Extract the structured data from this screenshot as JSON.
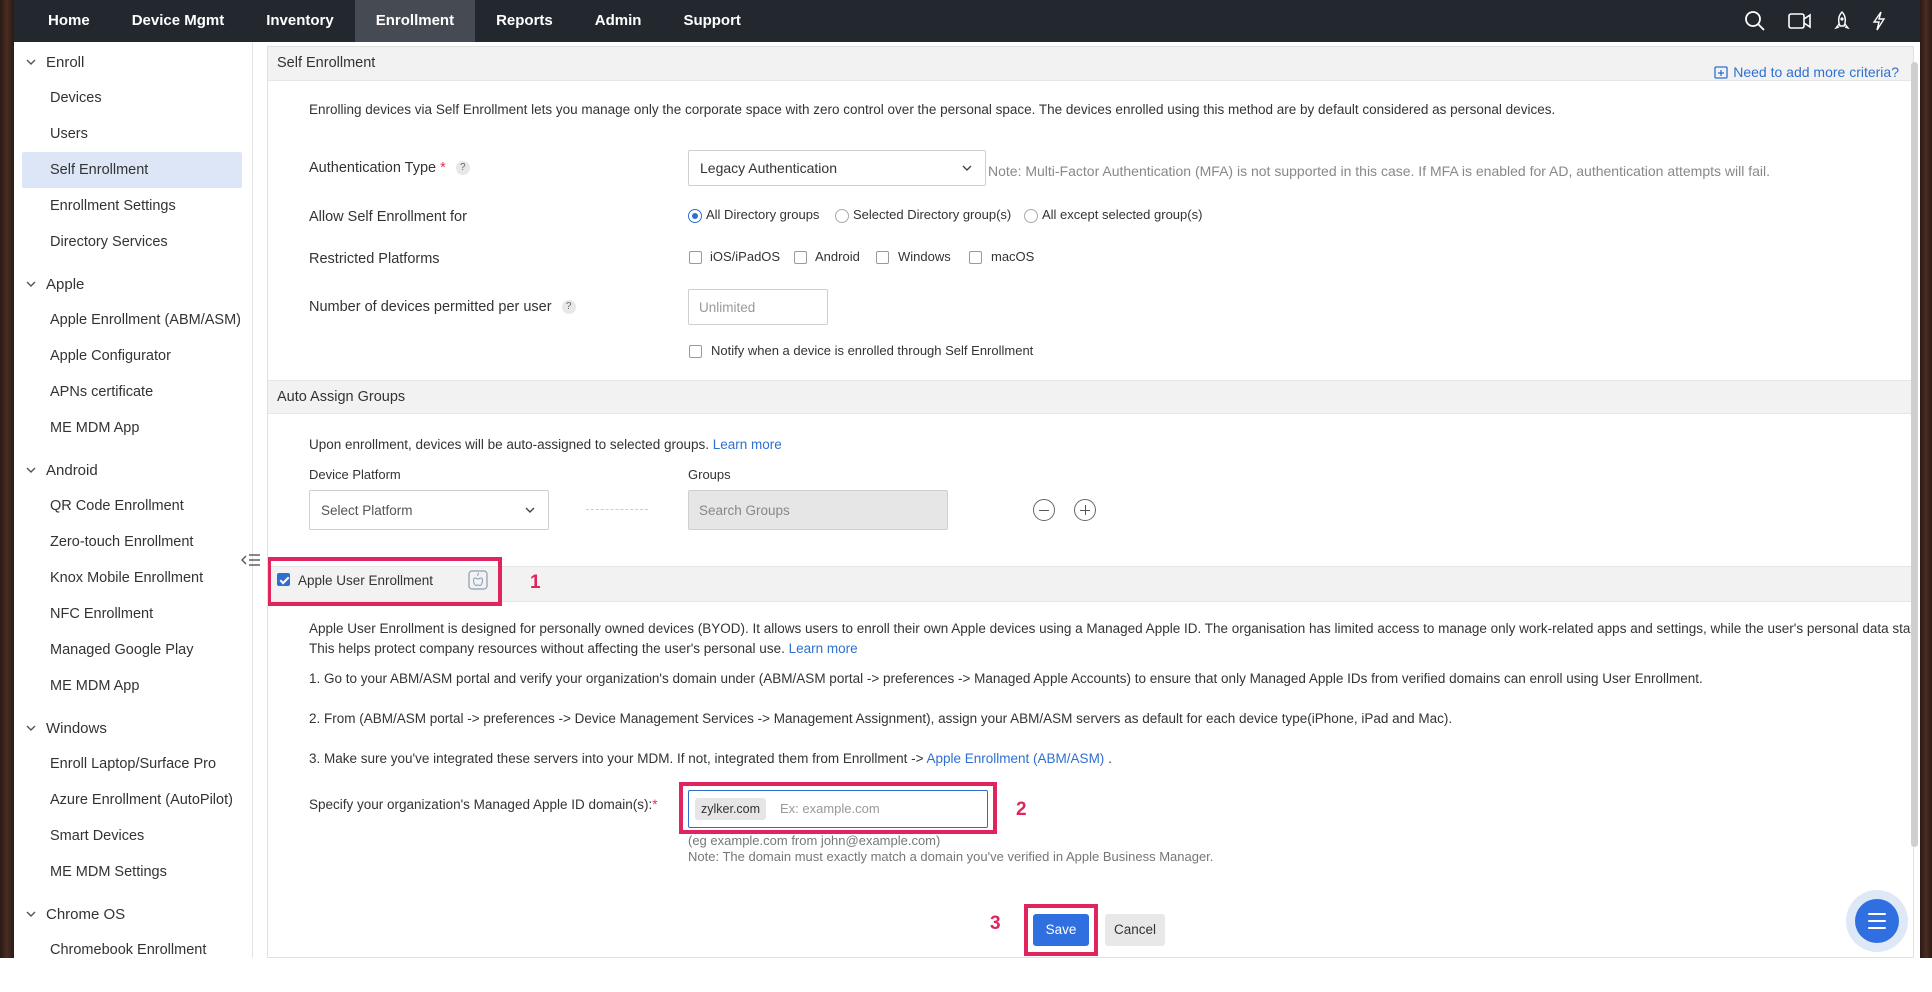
{
  "topnav": {
    "items": [
      "Home",
      "Device Mgmt",
      "Inventory",
      "Enrollment",
      "Reports",
      "Admin",
      "Support"
    ],
    "active": "Enrollment",
    "icons": [
      "search-icon",
      "video-icon",
      "rocket-icon",
      "lightning-icon"
    ]
  },
  "sidebar": {
    "sections": [
      {
        "title": "Enroll",
        "items": [
          "Devices",
          "Users",
          "Self Enrollment",
          "Enrollment Settings",
          "Directory Services"
        ]
      },
      {
        "title": "Apple",
        "items": [
          "Apple Enrollment (ABM/ASM)",
          "Apple Configurator",
          "APNs certificate",
          "ME MDM App"
        ]
      },
      {
        "title": "Android",
        "items": [
          "QR Code Enrollment",
          "Zero-touch Enrollment",
          "Knox Mobile Enrollment",
          "NFC Enrollment",
          "Managed Google Play",
          "ME MDM App"
        ]
      },
      {
        "title": "Windows",
        "items": [
          "Enroll Laptop/Surface Pro",
          "Azure Enrollment (AutoPilot)",
          "Smart Devices",
          "ME MDM Settings"
        ]
      },
      {
        "title": "Chrome OS",
        "items": [
          "Chromebook Enrollment"
        ]
      }
    ],
    "active_item": "Self Enrollment"
  },
  "self_enrollment": {
    "title": "Self Enrollment",
    "criteria_link": "Need to add more criteria?",
    "intro": "Enrolling devices via Self Enrollment lets you manage only the corporate space with zero control over the personal space. The devices enrolled using this method are by default considered as personal devices.",
    "auth_label": "Authentication Type",
    "required_mark": "*",
    "auth_value": "Legacy Authentication",
    "auth_note": "Note: Multi-Factor Authentication (MFA) is not supported in this case. If MFA is enabled for AD, authentication attempts will fail.",
    "allow_label": "Allow Self Enrollment for",
    "allow_options": [
      "All Directory groups",
      "Selected Directory group(s)",
      "All except selected group(s)"
    ],
    "allow_selected": 0,
    "restricted_label": "Restricted Platforms",
    "platforms": [
      "iOS/iPadOS",
      "Android",
      "Windows",
      "macOS"
    ],
    "devices_label": "Number of devices permitted per user",
    "devices_placeholder": "Unlimited",
    "notify_label": "Notify when a device is enrolled through Self Enrollment",
    "help_glyph": "?"
  },
  "auto_assign": {
    "title": "Auto Assign Groups",
    "desc": "Upon enrollment, devices will be auto-assigned to selected groups.",
    "learn_more": "Learn more",
    "platform_label": "Device Platform",
    "platform_placeholder": "Select Platform",
    "groups_label": "Groups",
    "groups_placeholder": "Search Groups"
  },
  "user_enrollment": {
    "checkbox_label": "Apple User Enrollment",
    "checked": true,
    "desc_line1": "Apple User Enrollment is designed for personally owned devices (BYOD). It allows users to enroll their own Apple devices using a Managed Apple ID. The organisation has limited access to manage only work-related apps and settings, while the user's personal data stays private.",
    "desc_line2": "This helps protect company resources without affecting the user's personal use.",
    "learn_more": "Learn more",
    "step1": "1. Go to your ABM/ASM portal and verify your organization's domain under (ABM/ASM portal -> preferences -> Managed Apple Accounts) to ensure that only Managed Apple IDs from verified domains can enroll using User Enrollment.",
    "step2": "2. From (ABM/ASM portal -> preferences -> Device Management Services -> Management Assignment), assign your ABM/ASM servers as default for each device type(iPhone, iPad and Mac).",
    "step3_prefix": "3. Make sure you've integrated these servers into your MDM. If not, integrated them from Enrollment ->",
    "step3_link": "Apple Enrollment (ABM/ASM)",
    "step3_suffix": ".",
    "domain_label": "Specify your organization's Managed Apple ID domain(s):",
    "domain_chip": "zylker.com",
    "domain_placeholder": "Ex: example.com",
    "hint1": "(eg example.com from john@example.com)",
    "hint2": "Note: The domain must exactly match a domain you've verified in Apple Business Manager."
  },
  "actions": {
    "save": "Save",
    "cancel": "Cancel"
  },
  "annotations": {
    "one": "1",
    "two": "2",
    "three": "3"
  },
  "colors": {
    "accent": "#2f6fe0",
    "highlight": "#e0245e",
    "nav_bg": "#23272e"
  }
}
